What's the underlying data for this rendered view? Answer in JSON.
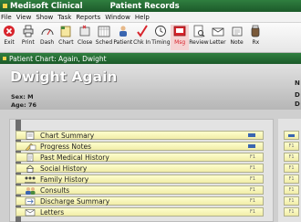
{
  "window": {
    "app_title": "Medisoft Clinical",
    "module_title": "Patient Records"
  },
  "menu": [
    "File",
    "View",
    "Show",
    "Task",
    "Reports",
    "Window",
    "Help"
  ],
  "toolbar": [
    {
      "label": "Exit",
      "icon": "exit-icon"
    },
    {
      "label": "Print",
      "icon": "print-icon"
    },
    {
      "label": "Dash",
      "icon": "dashboard-icon"
    },
    {
      "label": "Chart",
      "icon": "chart-icon"
    },
    {
      "label": "Close",
      "icon": "close-chart-icon"
    },
    {
      "label": "Sched",
      "icon": "schedule-icon"
    },
    {
      "label": "Patient",
      "icon": "patient-icon"
    },
    {
      "label": "Chk In",
      "icon": "check-in-icon"
    },
    {
      "label": "Timing",
      "icon": "timer-icon"
    },
    {
      "label": "Msg",
      "icon": "message-icon",
      "active": true
    },
    {
      "label": "Review",
      "icon": "review-icon"
    },
    {
      "label": "Letter",
      "icon": "letter-icon"
    },
    {
      "label": "Note",
      "icon": "note-icon"
    },
    {
      "label": "Rx",
      "icon": "prescription-icon"
    }
  ],
  "chart_tab": "Patient Chart: Again, Dwight",
  "patient": {
    "name": "Dwight Again",
    "sex_line": "Sex: M",
    "age_line": "Age: 76"
  },
  "right_header_letters": [
    "N",
    "D",
    "D"
  ],
  "chart_sections": [
    {
      "label": "Chart Summary",
      "icon": "summary-icon",
      "flag": "blue"
    },
    {
      "label": "Progress Notes",
      "icon": "notes-icon",
      "flag": "blue"
    },
    {
      "label": "Past Medical History",
      "icon": "history-icon",
      "flag": "F1"
    },
    {
      "label": "Social History",
      "icon": "house-icon",
      "flag": "F1"
    },
    {
      "label": "Family History",
      "icon": "family-icon",
      "flag": "F1"
    },
    {
      "label": "Consults",
      "icon": "consults-icon",
      "flag": "F1"
    },
    {
      "label": "Discharge Summary",
      "icon": "discharge-icon",
      "flag": "F1"
    },
    {
      "label": "Letters",
      "icon": "letters-icon",
      "flag": "F1"
    }
  ],
  "right_tabs": [
    "blue",
    "F1",
    "F1",
    "F1",
    "F1",
    "F1",
    "F1",
    "F1"
  ],
  "colors": {
    "flag_blue": "#3a65b0",
    "title_green": "#236b33",
    "msg_red": "#d8242c"
  }
}
